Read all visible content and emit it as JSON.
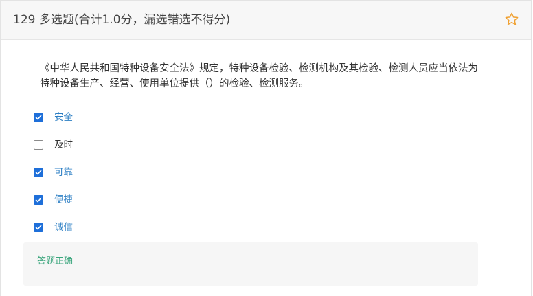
{
  "header": {
    "title": "129 多选题(合计1.0分，漏选错选不得分)",
    "star_icon": "star-outline-icon",
    "accent_color": "#f0a030"
  },
  "question": {
    "text": "《中华人民共和国特种设备安全法》规定，特种设备检验、检测机构及其检验、检测人员应当依法为特种设备生产、经营、使用单位提供（）的检验、检测服务。"
  },
  "options": [
    {
      "label": "安全",
      "checked": true
    },
    {
      "label": "及时",
      "checked": false
    },
    {
      "label": "可靠",
      "checked": true
    },
    {
      "label": "便捷",
      "checked": true
    },
    {
      "label": "诚信",
      "checked": true
    }
  ],
  "result": {
    "text": "答题正确",
    "color": "#3aa57c"
  },
  "colors": {
    "checkbox_checked": "#1e6fd9",
    "selected_label": "#2d7fc4"
  }
}
